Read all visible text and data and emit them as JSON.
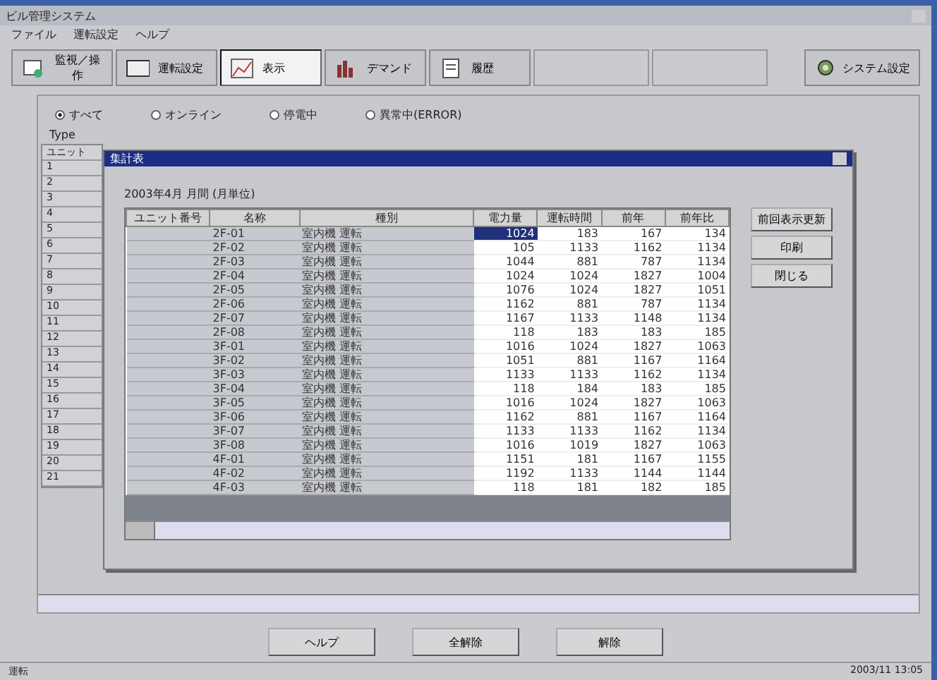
{
  "window": {
    "title": "ビル管理システム"
  },
  "menu": [
    "ファイル",
    "運転設定",
    "ヘルプ"
  ],
  "tabs": [
    {
      "label": "監視／操作",
      "selected": false
    },
    {
      "label": "運転設定",
      "selected": false
    },
    {
      "label": "表示",
      "selected": true
    },
    {
      "label": "デマンド",
      "selected": false
    },
    {
      "label": "履歴",
      "selected": false
    }
  ],
  "system_button": "システム設定",
  "filters": [
    {
      "label": "すべて",
      "selected": true
    },
    {
      "label": "オンライン",
      "selected": false
    },
    {
      "label": "停電中",
      "selected": false
    },
    {
      "label": "異常中(ERROR)",
      "selected": false
    }
  ],
  "list_label": "Type",
  "background_list": {
    "header": "ユニット",
    "rows": [
      "1",
      "2",
      "3",
      "4",
      "5",
      "6",
      "7",
      "8",
      "9",
      "10",
      "11",
      "12",
      "13",
      "14",
      "15",
      "16",
      "17",
      "18",
      "19",
      "20",
      "21"
    ]
  },
  "dialog": {
    "title": "集計表",
    "caption": "2003年4月 月間 (月単位)",
    "buttons": [
      "前回表示更新",
      "印刷",
      "閉じる"
    ],
    "columns": [
      "ユニット番号",
      "名称",
      "種別",
      "電力量",
      "運転時間",
      "前年",
      "前年比"
    ],
    "rows": [
      {
        "cells": [
          "",
          "2F-01",
          "室内機 運転",
          "1024",
          "183",
          "167",
          "134"
        ],
        "selected": true
      },
      {
        "cells": [
          "",
          "2F-02",
          "室内機 運転",
          "105",
          "1133",
          "1162",
          "1134"
        ],
        "selected": false
      },
      {
        "cells": [
          "",
          "2F-03",
          "室内機 運転",
          "1044",
          "881",
          "787",
          "1134"
        ],
        "selected": false
      },
      {
        "cells": [
          "",
          "2F-04",
          "室内機 運転",
          "1024",
          "1024",
          "1827",
          "1004"
        ],
        "selected": false
      },
      {
        "cells": [
          "",
          "2F-05",
          "室内機 運転",
          "1076",
          "1024",
          "1827",
          "1051"
        ],
        "selected": false
      },
      {
        "cells": [
          "",
          "2F-06",
          "室内機 運転",
          "1162",
          "881",
          "787",
          "1134"
        ],
        "selected": false
      },
      {
        "cells": [
          "",
          "2F-07",
          "室内機 運転",
          "1167",
          "1133",
          "1148",
          "1134"
        ],
        "selected": false
      },
      {
        "cells": [
          "",
          "2F-08",
          "室内機 運転",
          "118",
          "183",
          "183",
          "185"
        ],
        "selected": false
      },
      {
        "cells": [
          "",
          "3F-01",
          "室内機 運転",
          "1016",
          "1024",
          "1827",
          "1063"
        ],
        "selected": false
      },
      {
        "cells": [
          "",
          "3F-02",
          "室内機 運転",
          "1051",
          "881",
          "1167",
          "1164"
        ],
        "selected": false
      },
      {
        "cells": [
          "",
          "3F-03",
          "室内機 運転",
          "1133",
          "1133",
          "1162",
          "1134"
        ],
        "selected": false
      },
      {
        "cells": [
          "",
          "3F-04",
          "室内機 運転",
          "118",
          "184",
          "183",
          "185"
        ],
        "selected": false
      },
      {
        "cells": [
          "",
          "3F-05",
          "室内機 運転",
          "1016",
          "1024",
          "1827",
          "1063"
        ],
        "selected": false
      },
      {
        "cells": [
          "",
          "3F-06",
          "室内機 運転",
          "1162",
          "881",
          "1167",
          "1164"
        ],
        "selected": false
      },
      {
        "cells": [
          "",
          "3F-07",
          "室内機 運転",
          "1133",
          "1133",
          "1162",
          "1134"
        ],
        "selected": false
      },
      {
        "cells": [
          "",
          "3F-08",
          "室内機 運転",
          "1016",
          "1019",
          "1827",
          "1063"
        ],
        "selected": false
      },
      {
        "cells": [
          "",
          "4F-01",
          "室内機 運転",
          "1151",
          "181",
          "1167",
          "1155"
        ],
        "selected": false
      },
      {
        "cells": [
          "",
          "4F-02",
          "室内機 運転",
          "1192",
          "1133",
          "1144",
          "1144"
        ],
        "selected": false
      },
      {
        "cells": [
          "",
          "4F-03",
          "室内機 運転",
          "118",
          "181",
          "182",
          "185"
        ],
        "selected": false
      }
    ]
  },
  "bottom_buttons": [
    "ヘルプ",
    "全解除",
    "解除"
  ],
  "status_bar": {
    "left": "運転",
    "right": "2003/11 13:05"
  }
}
